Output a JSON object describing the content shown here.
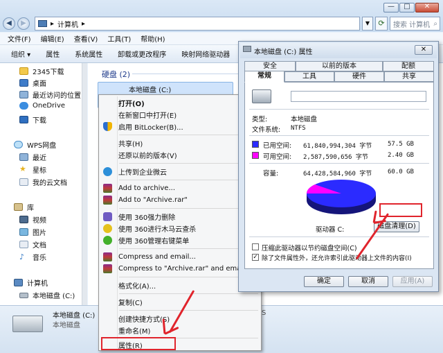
{
  "explorer": {
    "address_path": "计算机",
    "search_placeholder": "搜索 计算机",
    "menu": [
      "文件(F)",
      "编辑(E)",
      "查看(V)",
      "工具(T)",
      "帮助(H)"
    ],
    "toolbar": [
      "组织 ▾",
      "属性",
      "系统属性",
      "卸载或更改程序",
      "映射网络驱动器"
    ],
    "nav": {
      "top_items": [
        "2345下载",
        "桌面",
        "最近访问的位置",
        "OneDrive",
        "下载"
      ],
      "wps_group": "WPS网盘",
      "wps_items": [
        "最近",
        "星标",
        "我的云文档"
      ],
      "libraries": "库",
      "library_items": [
        "视频",
        "图片",
        "文档",
        "音乐"
      ],
      "computer": "计算机",
      "computer_items": [
        "本地磁盘 (C:)"
      ]
    },
    "content": {
      "group_title": "硬盘 (2)",
      "drive_label": "本地磁盘 (C:)"
    },
    "status": {
      "drive_name": "本地磁盘 (C:)",
      "drive_type": "本地磁盘",
      "fs_fragment": "S"
    }
  },
  "context_menu": {
    "items": [
      "打开(O)",
      "在新窗口中打开(E)",
      "启用 BitLocker(B)...",
      "共享(H)",
      "还原以前的版本(V)",
      "上传到企业微云",
      "Add to archive...",
      "Add to \"Archive.rar\"",
      "使用 360强力删除",
      "使用 360进行木马云查杀",
      "使用 360管理右键菜单",
      "Compress and email...",
      "Compress to \"Archive.rar\" and email",
      "格式化(A)...",
      "复制(C)",
      "创建快捷方式(S)",
      "重命名(M)",
      "属性(R)"
    ]
  },
  "dialog": {
    "title": "本地磁盘 (C:) 属性",
    "close_glyph": "✕",
    "tabs_row1": [
      "安全",
      "以前的版本",
      "配额"
    ],
    "tabs_row2": [
      "常规",
      "工具",
      "硬件",
      "共享"
    ],
    "type_label": "类型:",
    "type_value": "本地磁盘",
    "fs_label": "文件系统:",
    "fs_value": "NTFS",
    "used_label": "已用空间:",
    "used_bytes": "61,840,994,304 字节",
    "used_size": "57.5 GB",
    "free_label": "可用空间:",
    "free_bytes": "2,587,590,656 字节",
    "free_size": "2.40 GB",
    "capacity_label": "容量:",
    "capacity_bytes": "64,428,584,960 字节",
    "capacity_size": "60.0 GB",
    "drive_label": "驱动器 C:",
    "cleanup_button": "磁盘清理(D)",
    "compress_option": "压缩此驱动器以节约磁盘空间(C)",
    "index_option": "除了文件属性外，还允许索引此驱动器上文件的内容(I)",
    "ok": "确定",
    "cancel": "取消",
    "apply": "应用(A)",
    "colors": {
      "used": "#2b2bff",
      "free": "#ff00ff"
    }
  }
}
